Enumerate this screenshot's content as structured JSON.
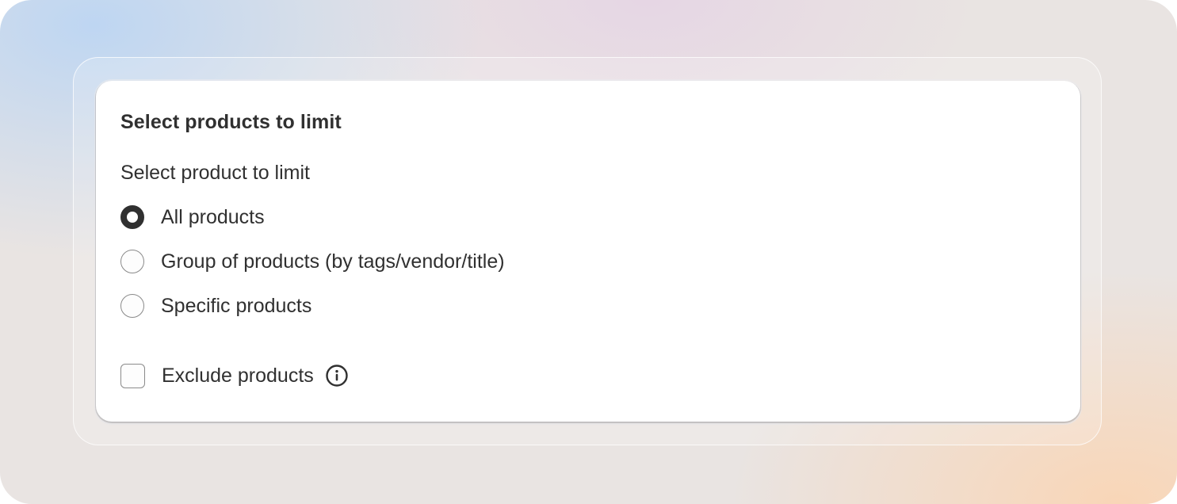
{
  "section": {
    "title": "Select products to limit",
    "subtitle": "Select product to limit"
  },
  "options": [
    {
      "label": "All products",
      "checked": true
    },
    {
      "label": "Group of products (by tags/vendor/title)",
      "checked": false
    },
    {
      "label": "Specific products",
      "checked": false
    }
  ],
  "exclude": {
    "label": "Exclude products",
    "checked": false,
    "icon": "info-icon"
  }
}
